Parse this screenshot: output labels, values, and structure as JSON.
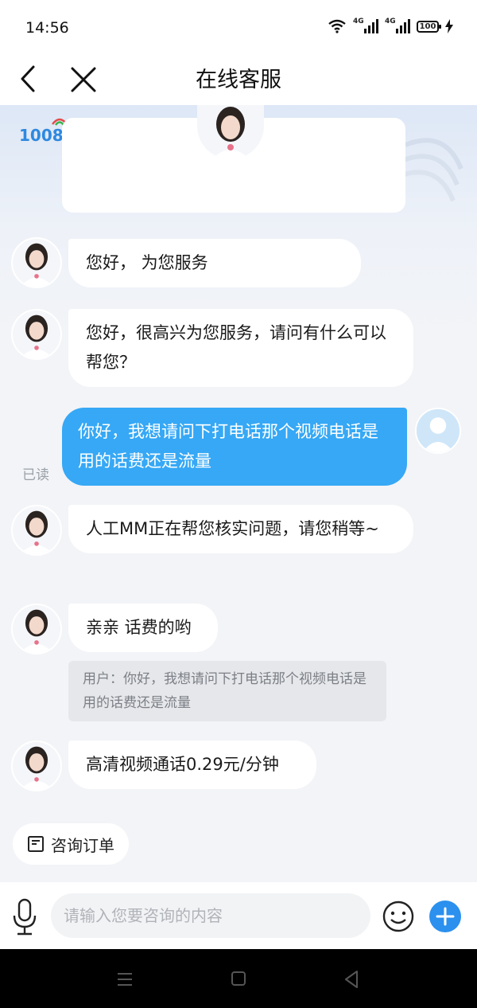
{
  "status_bar": {
    "time": "14:56",
    "network_1": "4G",
    "network_2": "4G",
    "battery": "100"
  },
  "header": {
    "title": "在线客服"
  },
  "banner": {
    "logo_text": "1008"
  },
  "messages": [
    {
      "type": "agent",
      "text": "您好，                              为您服务"
    },
    {
      "type": "agent",
      "text": "您好，很高兴为您服务，请问有什么可以帮您？"
    },
    {
      "type": "user",
      "text": "你好，我想请问下打电话那个视频电话是用的话费还是流量",
      "status": "已读"
    },
    {
      "type": "agent",
      "text": "人工MM正在帮您核实问题，请您稍等~"
    },
    {
      "type": "agent",
      "text": "亲亲 话费的哟",
      "quote": "用户：你好，我想请问下打电话那个视频电话是用的话费还是流量"
    },
    {
      "type": "agent",
      "text": "高清视频通话0.29元/分钟"
    }
  ],
  "quick_action": {
    "label": "咨询订单",
    "icon": "document-icon"
  },
  "input": {
    "placeholder": "请输入您要咨询的内容",
    "value": ""
  },
  "colors": {
    "accent": "#36a8f5",
    "plus": "#2b90ee",
    "background": "#f3f4f7"
  }
}
